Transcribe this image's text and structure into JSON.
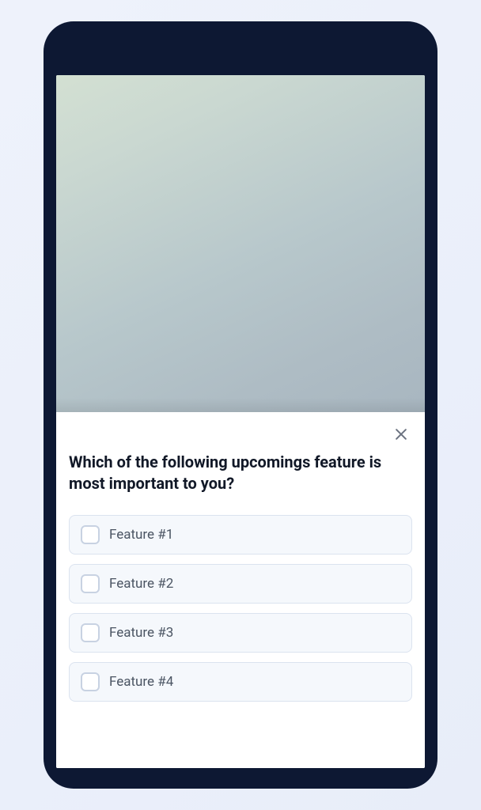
{
  "survey": {
    "question": "Which of the following upcomings feature is most important to you?",
    "options": [
      {
        "label": "Feature #1"
      },
      {
        "label": "Feature #2"
      },
      {
        "label": "Feature #3"
      },
      {
        "label": "Feature #4"
      }
    ]
  }
}
